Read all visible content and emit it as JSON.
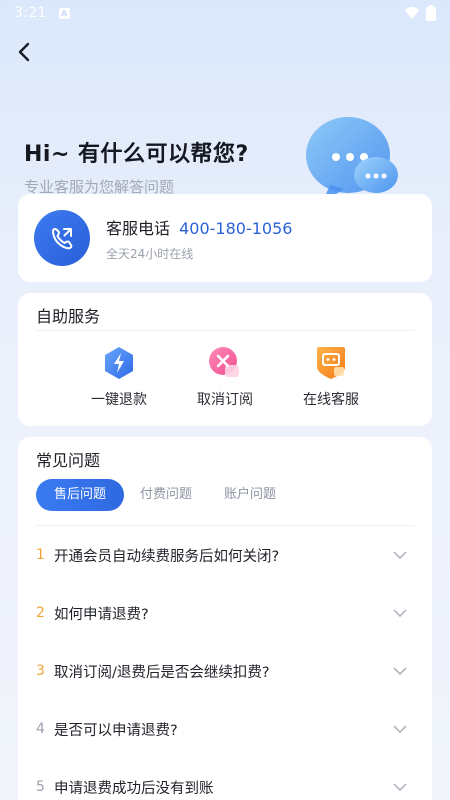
{
  "status_bar": {
    "time": "3:21",
    "notif_letter": "A"
  },
  "hero": {
    "title": "Hi~ 有什么可以帮您?",
    "subtitle": "专业客服为您解答问题"
  },
  "contact": {
    "label": "客服电话",
    "phone": "400-180-1056",
    "hours": "全天24小时在线"
  },
  "self_service": {
    "title": "自助服务",
    "items": [
      {
        "label": "一键退款",
        "icon": "lightning-refund-icon"
      },
      {
        "label": "取消订阅",
        "icon": "cancel-subscribe-icon"
      },
      {
        "label": "在线客服",
        "icon": "online-service-icon"
      }
    ]
  },
  "faq": {
    "title": "常见问题",
    "tabs": [
      "售后问题",
      "付费问题",
      "账户问题"
    ],
    "active_tab": "售后问题",
    "items": [
      {
        "num": "1",
        "q": "开通会员自动续费服务后如何关闭?"
      },
      {
        "num": "2",
        "q": "如何申请退费?"
      },
      {
        "num": "3",
        "q": "取消订阅/退费后是否会继续扣费?"
      },
      {
        "num": "4",
        "q": "是否可以申请退费?"
      },
      {
        "num": "5",
        "q": "申请退费成功后没有到账"
      }
    ]
  },
  "colors": {
    "accent": "#2f69e0",
    "highlight_num": "#f0a436",
    "phone_num": "#2b62d6"
  }
}
